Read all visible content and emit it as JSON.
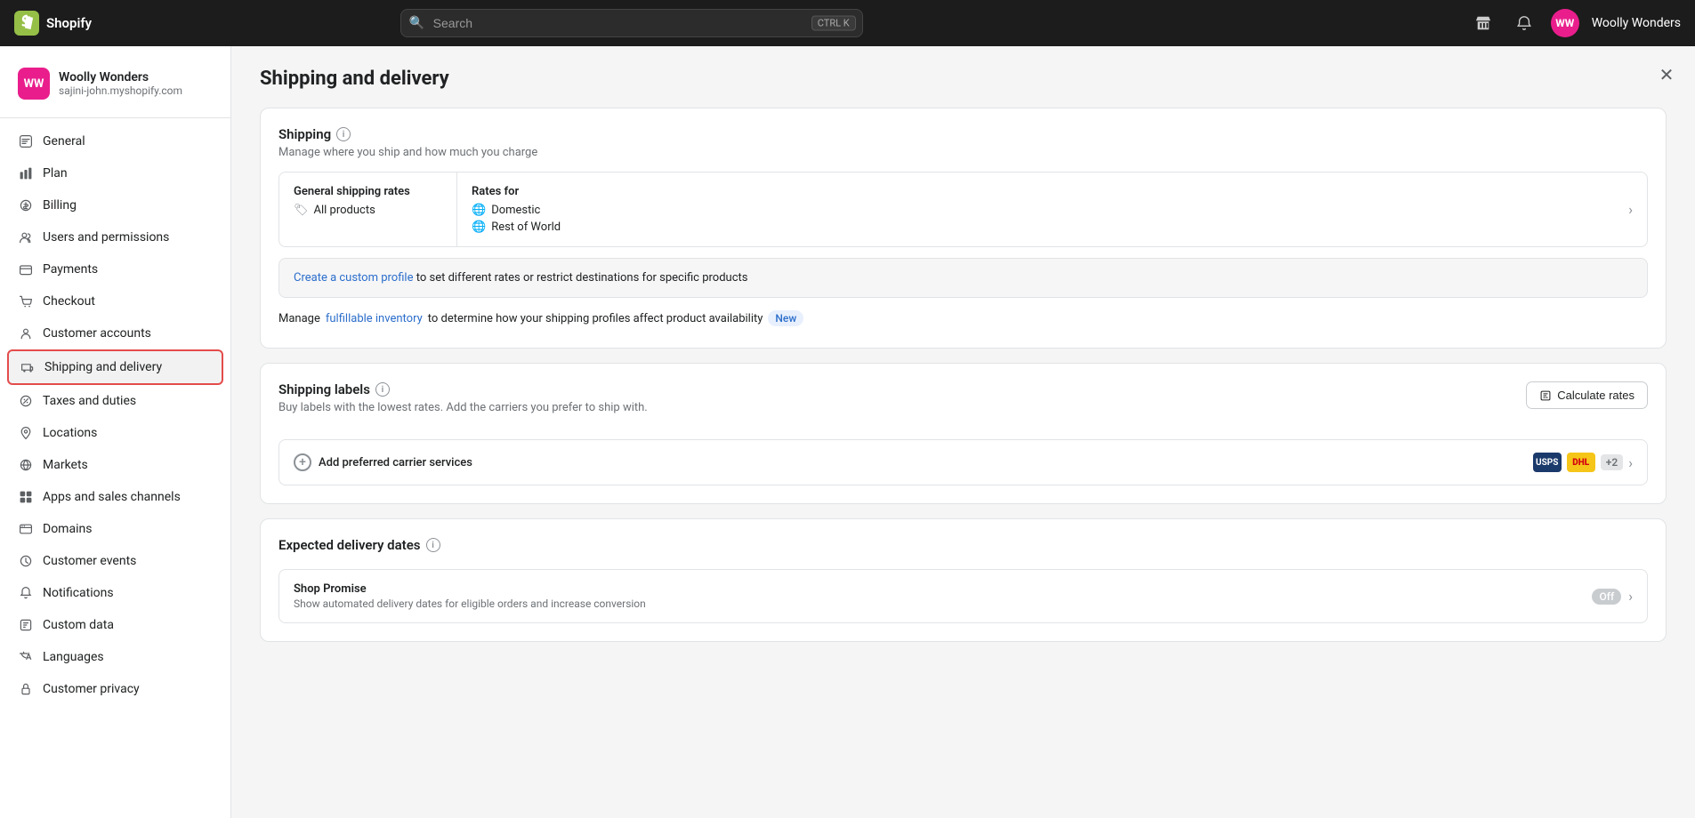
{
  "topnav": {
    "brand": "Shopify",
    "search_placeholder": "Search",
    "search_shortcut": "CTRL K",
    "user_initials": "WW",
    "username": "Woolly Wonders"
  },
  "sidebar": {
    "store_name": "Woolly Wonders",
    "store_url": "sajini-john.myshopify.com",
    "store_initials": "WW",
    "nav_items": [
      {
        "id": "general",
        "label": "General"
      },
      {
        "id": "plan",
        "label": "Plan"
      },
      {
        "id": "billing",
        "label": "Billing"
      },
      {
        "id": "users",
        "label": "Users and permissions"
      },
      {
        "id": "payments",
        "label": "Payments"
      },
      {
        "id": "checkout",
        "label": "Checkout"
      },
      {
        "id": "customer-accounts",
        "label": "Customer accounts"
      },
      {
        "id": "shipping",
        "label": "Shipping and delivery",
        "active": true
      },
      {
        "id": "taxes",
        "label": "Taxes and duties"
      },
      {
        "id": "locations",
        "label": "Locations"
      },
      {
        "id": "markets",
        "label": "Markets"
      },
      {
        "id": "apps",
        "label": "Apps and sales channels"
      },
      {
        "id": "domains",
        "label": "Domains"
      },
      {
        "id": "customer-events",
        "label": "Customer events"
      },
      {
        "id": "notifications",
        "label": "Notifications"
      },
      {
        "id": "custom-data",
        "label": "Custom data"
      },
      {
        "id": "languages",
        "label": "Languages"
      },
      {
        "id": "customer-privacy",
        "label": "Customer privacy"
      }
    ]
  },
  "main": {
    "page_title": "Shipping and delivery",
    "shipping_card": {
      "title": "Shipping",
      "subtitle": "Manage where you ship and how much you charge",
      "general_rates_label": "General shipping rates",
      "all_products_label": "All products",
      "rates_for_label": "Rates for",
      "domestic_label": "Domestic",
      "rest_of_world_label": "Rest of World",
      "custom_profile_text": "to set different rates or restrict destinations for specific products",
      "custom_profile_link": "Create a custom profile",
      "manage_text": "Manage",
      "fulfillable_link": "fulfillable inventory",
      "manage_suffix": "to determine how your shipping profiles affect product availability",
      "badge_new": "New"
    },
    "labels_card": {
      "title": "Shipping labels",
      "subtitle": "Buy labels with the lowest rates. Add the carriers you prefer to ship with.",
      "calculate_btn": "Calculate rates",
      "carrier_label": "Add preferred carrier services",
      "plus_count": "+2"
    },
    "delivery_dates_card": {
      "title": "Expected delivery dates",
      "shop_promise_title": "Shop Promise",
      "shop_promise_subtitle": "Show automated delivery dates for eligible orders and increase conversion",
      "toggle_label": "Off"
    }
  }
}
